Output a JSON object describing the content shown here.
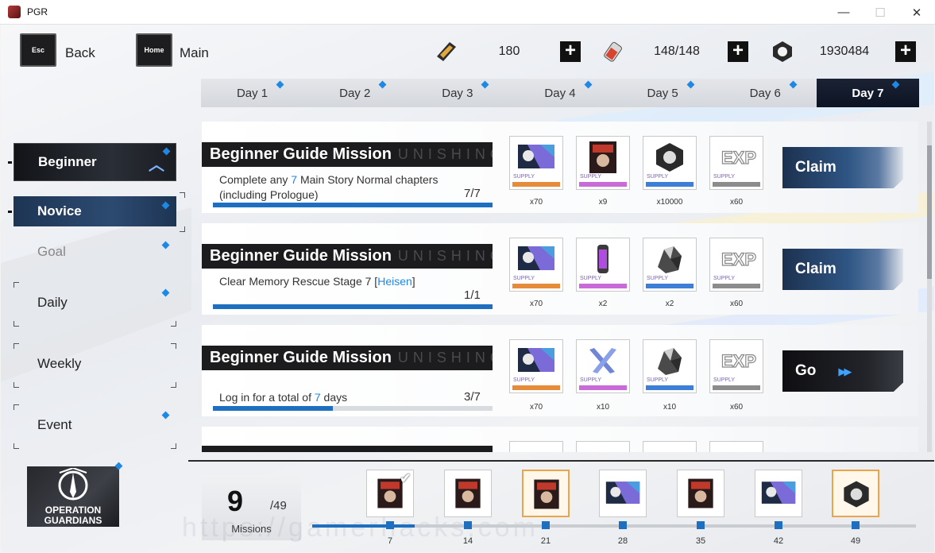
{
  "window": {
    "title": "PGR",
    "controls": {
      "minimize": "—",
      "maximize": "☐",
      "close": "✕"
    }
  },
  "nav": {
    "back": {
      "key": "Esc",
      "label": "Back"
    },
    "main": {
      "key": "Home",
      "label": "Main"
    }
  },
  "resources": [
    {
      "icon": "serum-ticket-icon",
      "value": "180"
    },
    {
      "icon": "serum-vial-icon",
      "value": "148/148"
    },
    {
      "icon": "cog-coin-icon",
      "value": "1930484"
    }
  ],
  "day_tabs": {
    "items": [
      "Day 1",
      "Day 2",
      "Day 3",
      "Day 4",
      "Day 5",
      "Day 6",
      "Day 7"
    ],
    "active": 6
  },
  "categories": [
    {
      "label": "Beginner",
      "style": "dark",
      "expanded": true
    },
    {
      "label": "Novice",
      "style": "selected"
    },
    {
      "label": "Goal",
      "style": "muted"
    },
    {
      "label": "Daily",
      "style": "plain"
    },
    {
      "label": "Weekly",
      "style": "plain"
    },
    {
      "label": "Event",
      "style": "plain"
    }
  ],
  "missions": [
    {
      "title": "Beginner Guide Mission",
      "ghost": "UNISHING",
      "desc_pre": "Complete any ",
      "desc_hl": "7",
      "desc_post": " Main Story Normal chapters (including Prologue)",
      "progress": "7/7",
      "progress_fraction": 1.0,
      "action": "Claim",
      "rewards": [
        {
          "icon": "supply-ticket-icon",
          "label": "SUPPLY",
          "qty": "x70"
        },
        {
          "icon": "character-card-icon",
          "label": "SUPPLY",
          "qty": "x9"
        },
        {
          "icon": "cog-coin-icon",
          "label": "SUPPLY",
          "qty": "x10000"
        },
        {
          "icon": "exp-icon",
          "label": "SUPPLY",
          "qty": "x60"
        }
      ]
    },
    {
      "title": "Beginner Guide Mission",
      "ghost": "UNISHING",
      "desc_pre": "Clear Memory Rescue Stage 7 [",
      "desc_hl": "Heisen",
      "desc_post": "]",
      "progress": "1/1",
      "progress_fraction": 1.0,
      "action": "Claim",
      "rewards": [
        {
          "icon": "supply-ticket-icon",
          "label": "SUPPLY",
          "qty": "x70"
        },
        {
          "icon": "energy-vial-icon",
          "label": "SUPPLY",
          "qty": "x2"
        },
        {
          "icon": "crystal-ore-icon",
          "label": "SUPPLY",
          "qty": "x2"
        },
        {
          "icon": "exp-icon",
          "label": "SUPPLY",
          "qty": "x60"
        }
      ]
    },
    {
      "title": "Beginner Guide Mission",
      "ghost": "UNISHING",
      "desc_pre": "Log in for a total of ",
      "desc_hl": "7",
      "desc_post": " days",
      "progress": "3/7",
      "progress_fraction": 0.43,
      "action": "Go",
      "rewards": [
        {
          "icon": "supply-ticket-icon",
          "label": "SUPPLY",
          "qty": "x70"
        },
        {
          "icon": "crystal-blade-icon",
          "label": "SUPPLY",
          "qty": "x10"
        },
        {
          "icon": "crystal-ore-icon",
          "label": "SUPPLY",
          "qty": "x10"
        },
        {
          "icon": "exp-icon",
          "label": "SUPPLY",
          "qty": "x60"
        }
      ]
    }
  ],
  "event": {
    "logo_line1": "OPERATION",
    "logo_line2": "GUARDIANS",
    "missions_done": "9",
    "missions_total": "/49",
    "missions_label": "Missions",
    "milestones": [
      {
        "value": "7",
        "claimed": true,
        "gold": false
      },
      {
        "value": "14",
        "claimed": false,
        "gold": false
      },
      {
        "value": "21",
        "claimed": false,
        "gold": true
      },
      {
        "value": "28",
        "claimed": false,
        "gold": false
      },
      {
        "value": "35",
        "claimed": false,
        "gold": false
      },
      {
        "value": "42",
        "claimed": false,
        "gold": false
      },
      {
        "value": "49",
        "claimed": false,
        "gold": true
      }
    ],
    "progress_fraction": 0.17
  },
  "watermark": "https://gamerhacks.com",
  "colors": {
    "accent": "#1e88e5",
    "bar": "#1e6fbf",
    "dark": "#1c1c1e"
  }
}
